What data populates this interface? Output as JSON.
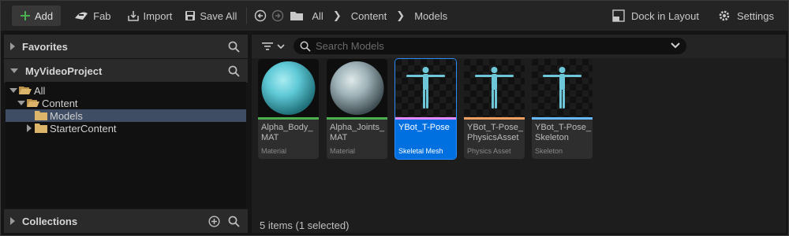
{
  "toolbar": {
    "add_label": "Add",
    "fab_label": "Fab",
    "import_label": "Import",
    "save_all_label": "Save All",
    "breadcrumbs": [
      "All",
      "Content",
      "Models"
    ],
    "dock_label": "Dock in Layout",
    "settings_label": "Settings"
  },
  "left_panel": {
    "favorites_label": "Favorites",
    "project_label": "MyVideoProject",
    "collections_label": "Collections",
    "tree": [
      {
        "label": "All",
        "expanded": true,
        "selected": false
      },
      {
        "label": "Content",
        "expanded": true,
        "selected": false
      },
      {
        "label": "Models",
        "expanded": false,
        "selected": true
      },
      {
        "label": "StarterContent",
        "expanded": false,
        "selected": false
      }
    ]
  },
  "content": {
    "search_placeholder": "Search Models",
    "assets": [
      {
        "name": "Alpha_Body_ MAT",
        "type": "Material",
        "strip_color": "#4caf50",
        "selected": false
      },
      {
        "name": "Alpha_Joints_ MAT",
        "type": "Material",
        "strip_color": "#4caf50",
        "selected": false
      },
      {
        "name": "YBot_T-Pose",
        "type": "Skeletal Mesh",
        "strip_color": "#e68bff",
        "selected": true
      },
      {
        "name": "YBot_T-Pose_ PhysicsAsset",
        "type": "Physics Asset",
        "strip_color": "#f0a060",
        "selected": false
      },
      {
        "name": "YBot_T-Pose_ Skeleton",
        "type": "Skeleton",
        "strip_color": "#66b8ff",
        "selected": false
      }
    ],
    "status": "5 items (1 selected)"
  },
  "colors": {
    "accent": "#0070e0",
    "add_icon": "#4caf50",
    "sphere_blue": "#5fc9d6",
    "sphere_grey": "#9fb3b8",
    "figure": "#6ec7d8"
  }
}
